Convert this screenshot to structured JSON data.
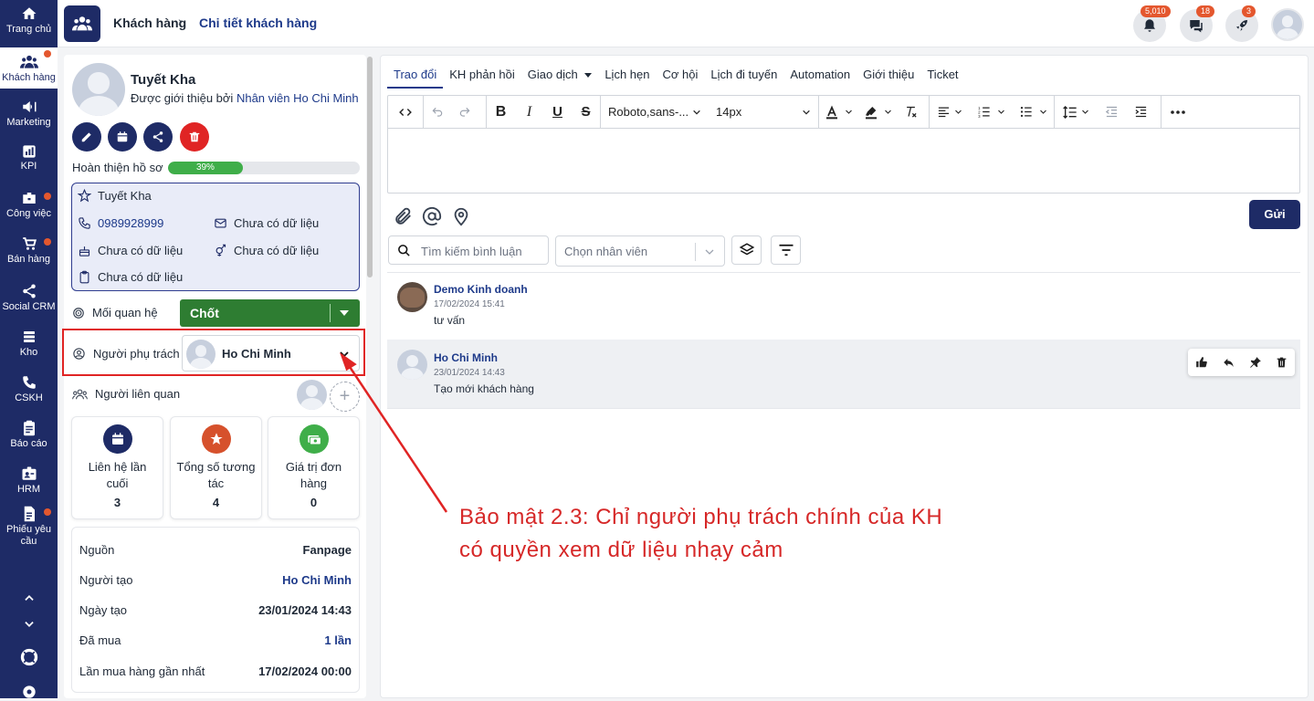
{
  "sidebar": {
    "items": [
      {
        "label": "Trang chủ",
        "icon": "home-icon",
        "dot": false
      },
      {
        "label": "Khách hàng",
        "icon": "customers-icon",
        "dot": true,
        "active": true
      },
      {
        "label": "Marketing",
        "icon": "megaphone-icon",
        "dot": false
      },
      {
        "label": "KPI",
        "icon": "kpi-chart-icon",
        "dot": false
      },
      {
        "label": "Công việc",
        "icon": "briefcase-icon",
        "dot": true
      },
      {
        "label": "Bán hàng",
        "icon": "cart-icon",
        "dot": true
      },
      {
        "label": "Social CRM",
        "icon": "share-icon",
        "dot": false
      },
      {
        "label": "Kho",
        "icon": "warehouse-icon",
        "dot": false
      },
      {
        "label": "CSKH",
        "icon": "phone-icon",
        "dot": false
      },
      {
        "label": "Báo cáo",
        "icon": "report-icon",
        "dot": false
      },
      {
        "label": "HRM",
        "icon": "hrm-icon",
        "dot": false
      },
      {
        "label": "Phiếu yêu cầu",
        "icon": "request-icon",
        "dot": true
      }
    ]
  },
  "header": {
    "breadcrumb_1": "Khách hàng",
    "breadcrumb_sep": "›",
    "breadcrumb_2": "Chi tiết khách hàng",
    "notifications_count": "5,010",
    "messages_count": "18",
    "rocket_count": "3"
  },
  "customer": {
    "name": "Tuyết Kha",
    "intro_prefix": "Được giới thiệu bởi",
    "intro_by": "Nhân viên Ho Chi Minh",
    "progress_label": "Hoàn thiện hồ sơ",
    "progress_text": "39%",
    "progress_value": 0.39,
    "info": {
      "name": "Tuyết Kha",
      "phone": "0989928999",
      "email": "Chưa có dữ liệu",
      "birthday": "Chưa có dữ liệu",
      "gender": "Chưa có dữ liệu",
      "note": "Chưa có dữ liệu"
    },
    "relationship_label": "Mối quan hệ",
    "relationship_value": "Chốt",
    "owner_label": "Người phụ trách",
    "owner_value": "Ho Chi Minh",
    "related_label": "Người liên quan",
    "related_add": "+"
  },
  "stats": [
    {
      "title": "Liên hệ lần cuối",
      "value": "3",
      "color": "#1e2b66",
      "icon": "calendar-icon"
    },
    {
      "title": "Tổng số tương tác",
      "value": "4",
      "color": "#d6512c",
      "icon": "star-icon"
    },
    {
      "title": "Giá trị đơn hàng",
      "value": "0",
      "color": "#3fae49",
      "icon": "money-icon"
    }
  ],
  "details": [
    {
      "key": "Nguồn",
      "value": "Fanpage",
      "link": false
    },
    {
      "key": "Người tạo",
      "value": "Ho Chi Minh",
      "link": true
    },
    {
      "key": "Ngày tạo",
      "value": "23/01/2024 14:43",
      "link": false
    },
    {
      "key": "Đã mua",
      "value": "1 lần",
      "link": true
    },
    {
      "key": "Lần mua hàng gần nhất",
      "value": "17/02/2024 00:00",
      "link": false
    }
  ],
  "tabs": [
    "Trao đổi",
    "KH phản hồi",
    "Giao dịch",
    "Lịch hẹn",
    "Cơ hội",
    "Lịch đi tuyến",
    "Automation",
    "Giới thiệu",
    "Ticket"
  ],
  "editor": {
    "font_family": "Roboto,sans-...",
    "font_size": "14px",
    "send_label": "Gửi"
  },
  "filters": {
    "search_placeholder": "Tìm kiếm bình luận",
    "staff_placeholder": "Chọn nhân viên"
  },
  "comments": [
    {
      "author": "Demo Kinh doanh",
      "time": "17/02/2024 15:41",
      "text": "tư vấn"
    },
    {
      "author": "Ho Chi Minh",
      "time": "23/01/2024 14:43",
      "text": "Tạo mới khách hàng"
    }
  ],
  "annotation": {
    "line1": "Bảo mật 2.3: Chỉ người phụ trách chính của KH",
    "line2": "có quyền xem dữ liệu nhạy cảm"
  },
  "colors": {
    "navy": "#1e2b66",
    "accent_red": "#e02424",
    "green": "#2e7d32"
  }
}
